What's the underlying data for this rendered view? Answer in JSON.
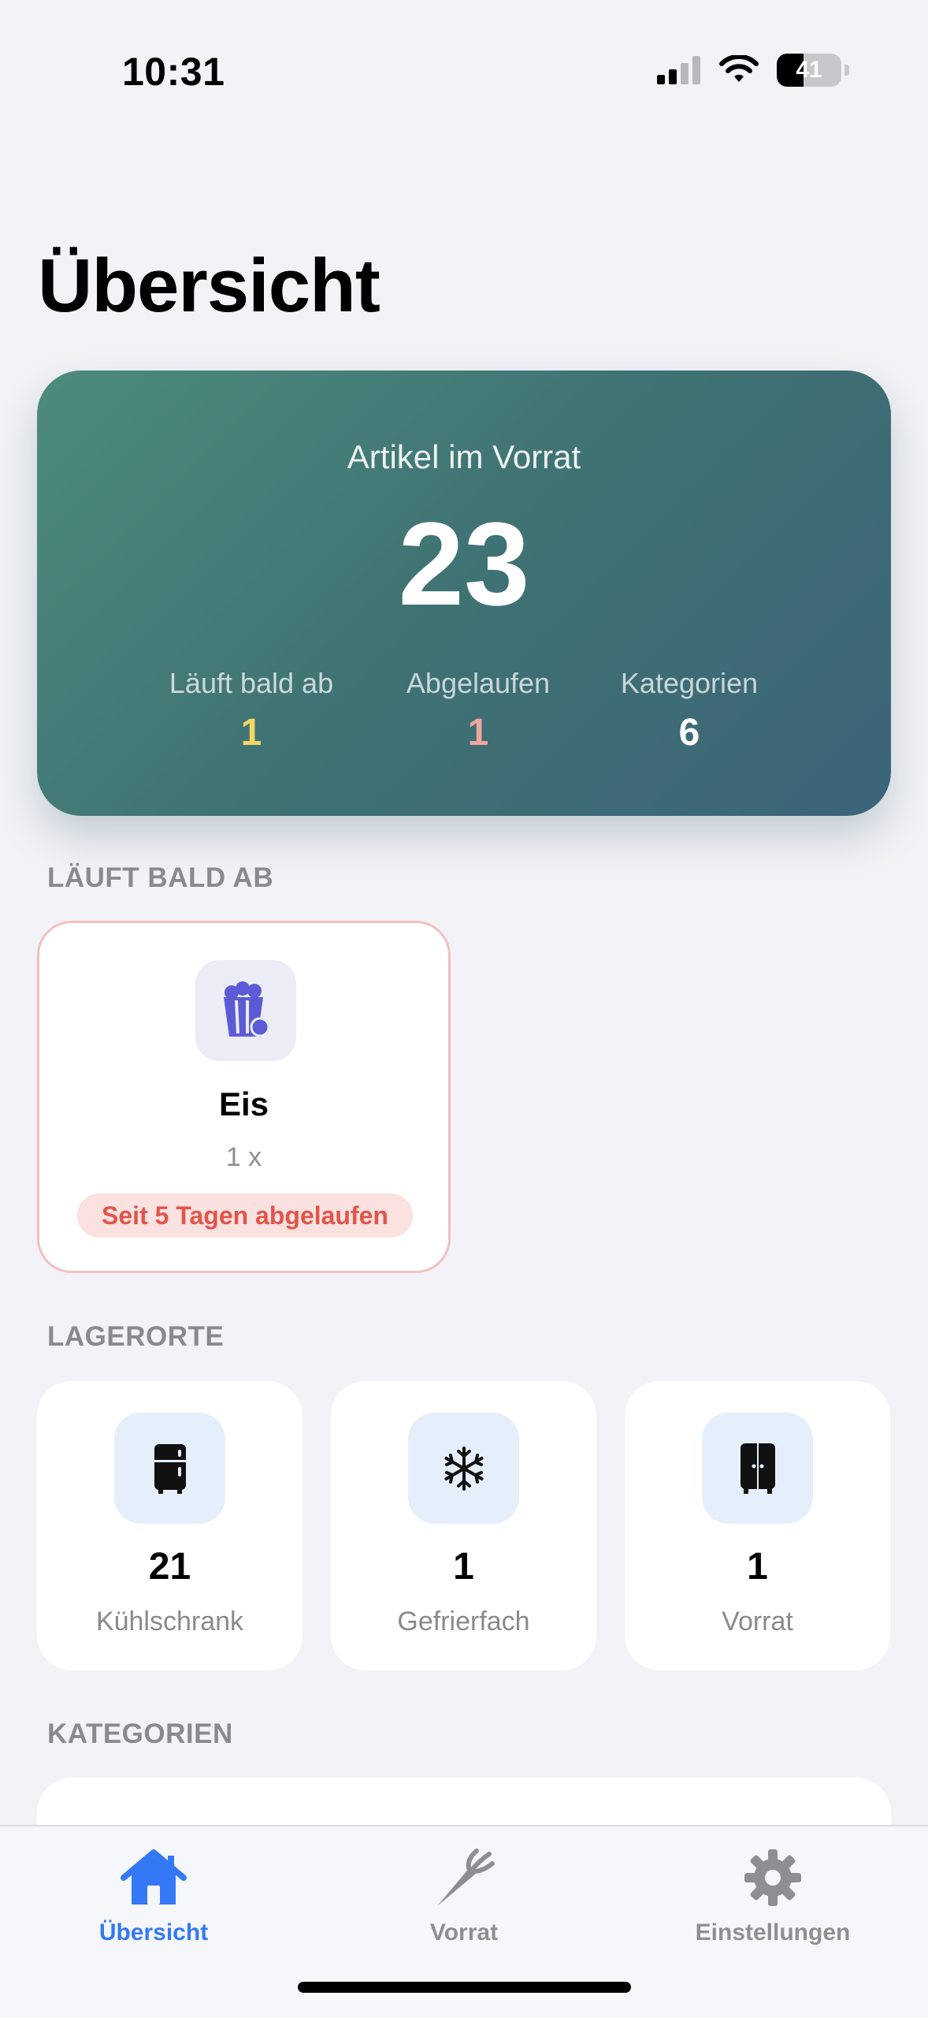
{
  "status_bar": {
    "time": "10:31",
    "battery": "41",
    "battery_level": 0.41,
    "icons": [
      "cellular-signal-icon",
      "wifi-icon",
      "battery-icon"
    ]
  },
  "page_title": "Übersicht",
  "summary": {
    "label": "Artikel im Vorrat",
    "count": "23",
    "stats": [
      {
        "label": "Läuft bald ab",
        "value": "1",
        "color": "#f5d564"
      },
      {
        "label": "Abgelaufen",
        "value": "1",
        "color": "#f0a6a0"
      },
      {
        "label": "Kategorien",
        "value": "6",
        "color": "#ffffff"
      }
    ]
  },
  "expiring": {
    "header": "LÄUFT BALD AB",
    "items": [
      {
        "name": "Eis",
        "quantity": "1 x",
        "badge": "Seit 5 Tagen abgelaufen",
        "icon": "popcorn-icon"
      }
    ]
  },
  "locations": {
    "header": "LAGERORTE",
    "items": [
      {
        "count": "21",
        "name": "Kühlschrank",
        "icon": "refrigerator-icon"
      },
      {
        "count": "1",
        "name": "Gefrierfach",
        "icon": "snowflake-icon"
      },
      {
        "count": "1",
        "name": "Vorrat",
        "icon": "cabinet-icon"
      }
    ]
  },
  "categories": {
    "header": "KATEGORIEN"
  },
  "tab_bar": {
    "tabs": [
      {
        "label": "Übersicht",
        "icon": "house-icon",
        "active": true
      },
      {
        "label": "Vorrat",
        "icon": "carrot-icon",
        "active": false
      },
      {
        "label": "Einstellungen",
        "icon": "gear-icon",
        "active": false
      }
    ],
    "accent": "#3478f6",
    "inactive": "#8e8e93"
  }
}
